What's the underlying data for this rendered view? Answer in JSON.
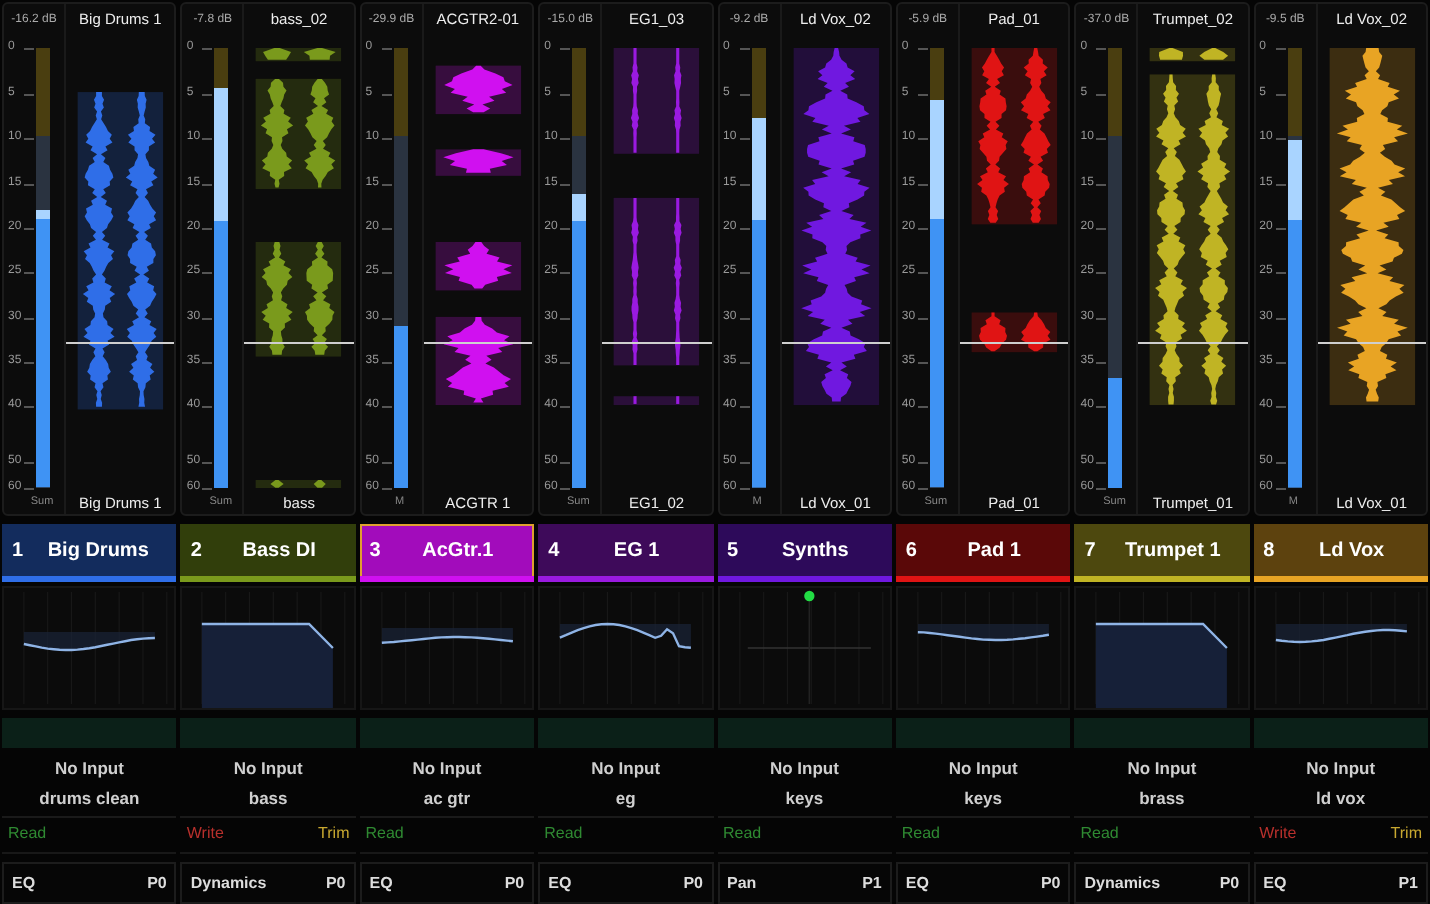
{
  "channels": [
    {
      "peak": "-16.2 dB",
      "scale": [
        "0",
        "5",
        "10",
        "15",
        "20",
        "25",
        "30",
        "35",
        "40",
        "50",
        "60"
      ],
      "level": 0.63,
      "meter_label": "Sum",
      "clip_top": "Big Drums 1",
      "clip_bottom": "Big Drums 1",
      "color": "#2f6ee8",
      "number": "1",
      "name": "Big Drums",
      "selected": false,
      "graph": {
        "kind": "eq"
      },
      "input": "No Input",
      "input_name": "drums clean",
      "automation": {
        "kind": "read",
        "label": "Read"
      },
      "insert": "EQ",
      "preset": "P0"
    },
    {
      "peak": "-7.8 dB",
      "scale": [
        "0",
        "5",
        "10",
        "15",
        "20",
        "25",
        "30",
        "35",
        "40",
        "50",
        "60"
      ],
      "level": 0.91,
      "meter_label": "Sum",
      "clip_top": "bass_02",
      "clip_bottom": "bass",
      "color": "#7a9a1c",
      "number": "2",
      "name": "Bass DI",
      "selected": false,
      "graph": {
        "kind": "dynamics"
      },
      "input": "No Input",
      "input_name": "bass",
      "automation": {
        "kind": "write",
        "label": "Write"
      },
      "trim": "Trim",
      "insert": "Dynamics",
      "preset": "P0"
    },
    {
      "peak": "-29.9 dB",
      "scale": [
        "0",
        "5",
        "10",
        "15",
        "20",
        "25",
        "30",
        "35",
        "40",
        "50",
        "60"
      ],
      "level": 0.37,
      "meter_label": "M",
      "clip_top": "ACGTR2-01",
      "clip_bottom": "ACGTR 1",
      "color": "#d010f0",
      "number": "3",
      "name": "AcGtr.1",
      "selected": true,
      "graph": {
        "kind": "eq"
      },
      "input": "No Input",
      "input_name": "ac gtr",
      "automation": {
        "kind": "read",
        "label": "Read"
      },
      "insert": "EQ",
      "preset": "P0"
    },
    {
      "peak": "-15.0 dB",
      "scale": [
        "0",
        "5",
        "10",
        "15",
        "20",
        "25",
        "30",
        "35",
        "40",
        "50",
        "60"
      ],
      "level": 0.67,
      "meter_label": "Sum",
      "clip_top": "EG1_03",
      "clip_bottom": "EG1_02",
      "color": "#9a1ae0",
      "number": "4",
      "name": "EG 1",
      "selected": false,
      "graph": {
        "kind": "eq"
      },
      "input": "No Input",
      "input_name": "eg",
      "automation": {
        "kind": "read",
        "label": "Read"
      },
      "insert": "EQ",
      "preset": "P0"
    },
    {
      "peak": "-9.2 dB",
      "scale": [
        "0",
        "5",
        "10",
        "15",
        "20",
        "25",
        "30",
        "35",
        "40",
        "50",
        "60"
      ],
      "level": 0.84,
      "meter_label": "M",
      "clip_top": "Ld Vox_02",
      "clip_bottom": "Ld Vox_01",
      "color": "#7018e0",
      "number": "5",
      "name": "Synths",
      "selected": false,
      "graph": {
        "kind": "pan"
      },
      "input": "No Input",
      "input_name": "keys",
      "automation": {
        "kind": "read",
        "label": "Read"
      },
      "insert": "Pan",
      "preset": "P1"
    },
    {
      "peak": "-5.9 dB",
      "scale": [
        "0",
        "5",
        "10",
        "15",
        "20",
        "25",
        "30",
        "35",
        "40",
        "50",
        "60"
      ],
      "level": 0.88,
      "meter_label": "Sum",
      "clip_top": "Pad_01",
      "clip_bottom": "Pad_01",
      "color": "#e01414",
      "number": "6",
      "name": "Pad 1",
      "selected": false,
      "graph": {
        "kind": "eq"
      },
      "input": "No Input",
      "input_name": "keys",
      "automation": {
        "kind": "read",
        "label": "Read"
      },
      "insert": "EQ",
      "preset": "P0"
    },
    {
      "peak": "-37.0 dB",
      "scale": [
        "0",
        "5",
        "10",
        "15",
        "20",
        "25",
        "30",
        "35",
        "40",
        "50",
        "60"
      ],
      "level": 0.25,
      "meter_label": "Sum",
      "clip_top": "Trumpet_02",
      "clip_bottom": "Trumpet_01",
      "color": "#c0b424",
      "number": "7",
      "name": "Trumpet 1",
      "selected": false,
      "graph": {
        "kind": "dynamics"
      },
      "input": "No Input",
      "input_name": "brass",
      "automation": {
        "kind": "read",
        "label": "Read"
      },
      "insert": "Dynamics",
      "preset": "P0"
    },
    {
      "peak": "-9.5 dB",
      "scale": [
        "0",
        "5",
        "10",
        "15",
        "20",
        "25",
        "30",
        "35",
        "40",
        "50",
        "60"
      ],
      "level": 0.79,
      "meter_label": "M",
      "clip_top": "Ld Vox_02",
      "clip_bottom": "Ld Vox_01",
      "color": "#e8a424",
      "number": "8",
      "name": "Ld Vox",
      "selected": false,
      "graph": {
        "kind": "eq"
      },
      "input": "No Input",
      "input_name": "ld vox",
      "automation": {
        "kind": "write",
        "label": "Write"
      },
      "trim": "Trim",
      "insert": "EQ",
      "preset": "P1"
    }
  ]
}
